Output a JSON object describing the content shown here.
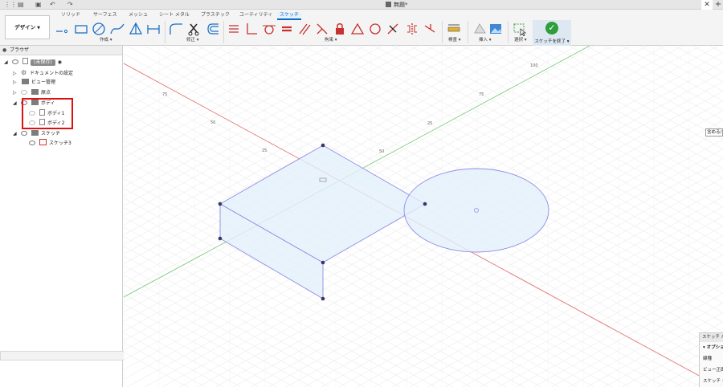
{
  "titlebar": {
    "grid_icon": "⋮⋮",
    "file_icon": "▤",
    "save_icon": "▣",
    "undo_icon": "↶",
    "redo_icon": "↷",
    "doc_title": "無題*",
    "close": "✕",
    "new_tab": "+"
  },
  "ribbon": {
    "workspace": "デザイン",
    "tabs": [
      "ソリッド",
      "サーフェス",
      "メッシュ",
      "シート メタル",
      "プラスチック",
      "ユーティリティ",
      "スケッチ"
    ],
    "groups": {
      "create": "作成 ▾",
      "modify": "修正 ▾",
      "constraints": "拘束 ▾",
      "inspect": "検査 ▾",
      "insert": "挿入 ▾",
      "select": "選択 ▾"
    },
    "finish_sketch": "スケッチを終了 ▾",
    "finish_icon": "✓"
  },
  "browser": {
    "title": "ブラウザ",
    "collapse_icon": "●",
    "rows": {
      "root": "(未保存)",
      "doc_settings": "ドキュメントの設定",
      "named_views": "ビュー管理",
      "origin": "原点",
      "bodies": "ボディ",
      "body1": "ボディ1",
      "body2": "ボディ2",
      "sketches": "スケッチ",
      "sketch3": "スケッチ3"
    }
  },
  "canvas": {
    "right_tag": "含める/",
    "grid_labels": [
      "75",
      "50",
      "25",
      "50",
      "25",
      "100",
      "75"
    ]
  },
  "palette": {
    "header": "スケッチ パレット",
    "options": "▾ オプション",
    "linetype": "線種",
    "lookat": "ビュー正面",
    "sketch_grid": "スケッチ グリッド"
  }
}
